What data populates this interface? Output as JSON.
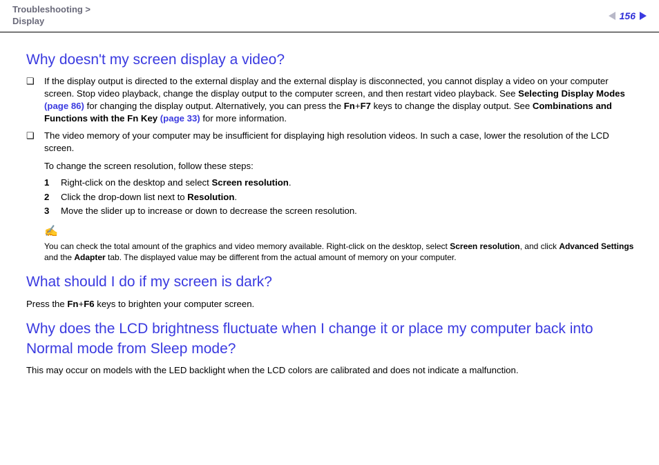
{
  "header": {
    "breadcrumb_top": "Troubleshooting >",
    "breadcrumb_sub": "Display",
    "page_number": "156"
  },
  "section1": {
    "heading": "Why doesn't my screen display a video?",
    "bullet1_pre": "If the display output is directed to the external display and the external display is disconnected, you cannot display a video on your computer screen. Stop video playback, change the display output to the computer screen, and then restart video playback. See ",
    "bullet1_link1_bold": "Selecting Display Modes ",
    "bullet1_link1_page": "(page 86)",
    "bullet1_mid": " for changing the display output. Alternatively, you can press the ",
    "bullet1_fn": "Fn",
    "bullet1_plus": "+",
    "bullet1_f7": "F7",
    "bullet1_mid2": " keys to change the display output. See ",
    "bullet1_link2_bold": "Combinations and Functions with the Fn Key ",
    "bullet1_link2_page": "(page 33)",
    "bullet1_end": " for more information.",
    "bullet2": "The video memory of your computer may be insufficient for displaying high resolution videos. In such a case, lower the resolution of the LCD screen.",
    "steps_intro": "To change the screen resolution, follow these steps:",
    "step1_pre": "Right-click on the desktop and select ",
    "step1_bold": "Screen resolution",
    "step2_pre": "Click the drop-down list next to ",
    "step2_bold": "Resolution",
    "step3": "Move the slider up to increase or down to decrease the screen resolution.",
    "note_icon": "✍",
    "note_pre": "You can check the total amount of the graphics and video memory available. Right-click on the desktop, select ",
    "note_b1": "Screen resolution",
    "note_mid1": ", and click ",
    "note_b2": "Advanced Settings",
    "note_mid2": " and the ",
    "note_b3": "Adapter",
    "note_end": " tab. The displayed value may be different from the actual amount of memory on your computer."
  },
  "section2": {
    "heading": "What should I do if my screen is dark?",
    "text_pre": "Press the ",
    "fn": "Fn",
    "plus": "+",
    "f6": "F6",
    "text_end": " keys to brighten your computer screen."
  },
  "section3": {
    "heading": "Why does the LCD brightness fluctuate when I change it or place my computer back into Normal mode from Sleep mode?",
    "text": "This may occur on models with the LED backlight when the LCD colors are calibrated and does not indicate a malfunction."
  }
}
